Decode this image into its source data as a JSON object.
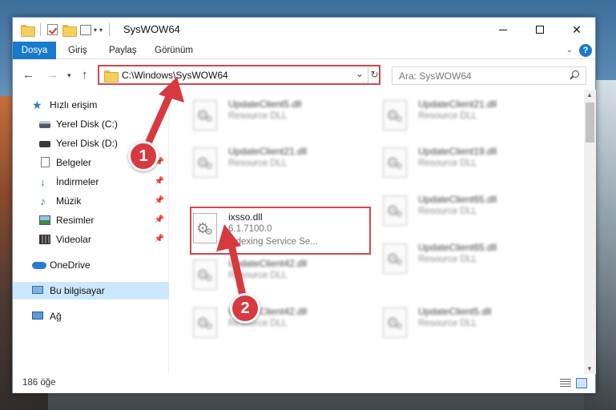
{
  "window": {
    "title": "SysWOW64"
  },
  "ribbon": {
    "tabs": [
      "Dosya",
      "Giriş",
      "Paylaş",
      "Görünüm"
    ],
    "help_label": "?"
  },
  "address": {
    "path": "C:\\Windows\\SysWOW64",
    "dropdown_icon": "chevron-down",
    "refresh_icon": "refresh"
  },
  "search": {
    "placeholder": "Ara: SysWOW64"
  },
  "navigation": {
    "items": [
      {
        "label": "Hızlı erişim",
        "icon": "star-icon",
        "pinned": false
      },
      {
        "label": "Yerel Disk (C:)",
        "icon": "disk-icon",
        "pinned": true
      },
      {
        "label": "Yerel Disk (D:)",
        "icon": "disk-icon",
        "pinned": true
      },
      {
        "label": "Belgeler",
        "icon": "document-icon",
        "pinned": true
      },
      {
        "label": "İndirmeler",
        "icon": "download-icon",
        "pinned": true
      },
      {
        "label": "Müzik",
        "icon": "music-icon",
        "pinned": true
      },
      {
        "label": "Resimler",
        "icon": "picture-icon",
        "pinned": true
      },
      {
        "label": "Videolar",
        "icon": "video-icon",
        "pinned": true
      },
      {
        "label": "OneDrive",
        "icon": "cloud-icon",
        "pinned": false
      },
      {
        "label": "Bu bilgisayar",
        "icon": "computer-icon",
        "pinned": false,
        "selected": true
      },
      {
        "label": "Ağ",
        "icon": "network-icon",
        "pinned": false
      }
    ]
  },
  "files": [
    {
      "name": "UpdateClient5.dll",
      "type": "Resource DLL"
    },
    {
      "name": "UpdateClient21.dll",
      "type": "Resource DLL"
    },
    {
      "name": "UpdateClient21.dll",
      "type": "Resource DLL"
    },
    {
      "name": "UpdateClient19.dll",
      "type": "Resource DLL"
    },
    {
      "name": "ixsso.dll",
      "version": "6.1.7100.0",
      "description": "Indexing Service Se...",
      "highlighted": true
    },
    {
      "name": "UpdateClient65.dll",
      "type": "Resource DLL"
    },
    {
      "name": "UpdateClient42.dll",
      "type": "Resource DLL"
    },
    {
      "name": "UpdateClient65.dll",
      "type": "Resource DLL"
    },
    {
      "name": "UpdateClient42.dll",
      "type": "Resource DLL"
    },
    {
      "name": "UpdateClient5.dll",
      "type": "Resource DLL"
    }
  ],
  "status": {
    "item_count": "186 öğe"
  },
  "annotations": {
    "step1": "1",
    "step2": "2",
    "color": "#d8393f"
  }
}
